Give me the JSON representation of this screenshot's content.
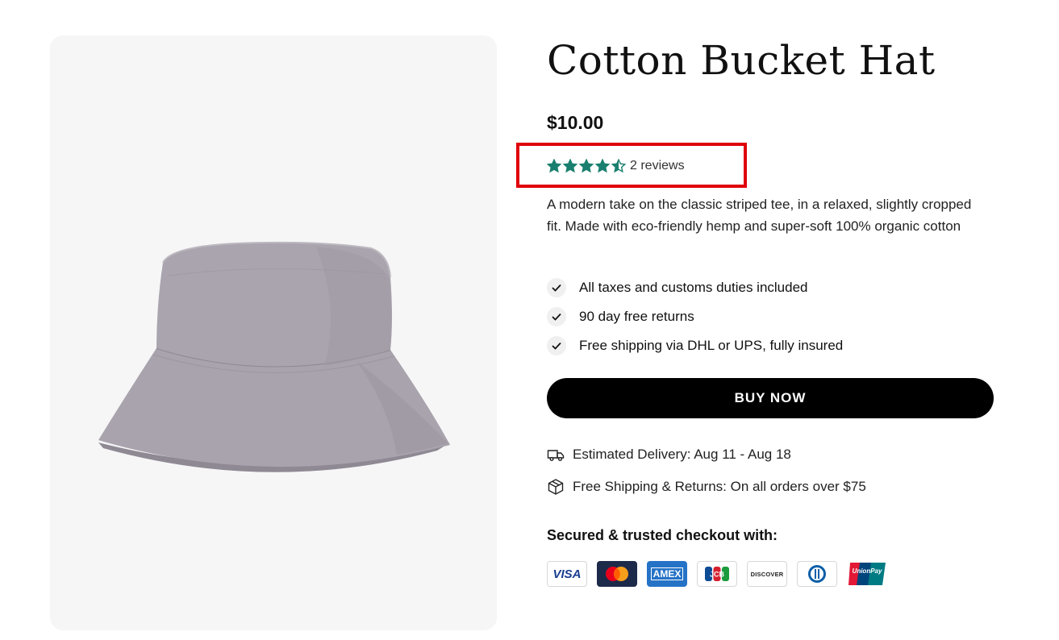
{
  "product": {
    "title": "Cotton Bucket Hat",
    "price": "$10.00",
    "rating": {
      "stars_value": 4.5,
      "stars_max": 5,
      "review_text": "2 reviews",
      "star_color": "#1a7f6e"
    },
    "description": "A modern take on the classic striped tee, in a relaxed, slightly cropped fit. Made with eco-friendly hemp and super-soft 100% organic cotton",
    "benefits": [
      "All taxes and customs duties included",
      "90 day free returns",
      "Free shipping via DHL or UPS, fully insured"
    ],
    "buy_button_label": "BUY NOW",
    "delivery_text": "Estimated Delivery: Aug 11 - Aug 18",
    "shipping_text": "Free Shipping & Returns: On all orders over $75",
    "secure_checkout_label": "Secured & trusted checkout with:",
    "payment_methods": [
      {
        "name": "visa",
        "label": "VISA",
        "icon": "visa-icon"
      },
      {
        "name": "mastercard",
        "label": "",
        "icon": "mastercard-icon"
      },
      {
        "name": "amex",
        "label": "AMEX",
        "icon": "amex-icon"
      },
      {
        "name": "jcb",
        "label": "JCB",
        "icon": "jcb-icon"
      },
      {
        "name": "discover",
        "label": "DISCOVER",
        "icon": "discover-icon"
      },
      {
        "name": "diners",
        "label": "",
        "icon": "diners-club-icon"
      },
      {
        "name": "unionpay",
        "label": "UnionPay",
        "icon": "unionpay-icon"
      }
    ]
  },
  "colors": {
    "accent_highlight": "#e0000a",
    "button_bg": "#000000",
    "image_bg": "#f6f6f6",
    "hat_color": "#a8a2ab"
  }
}
